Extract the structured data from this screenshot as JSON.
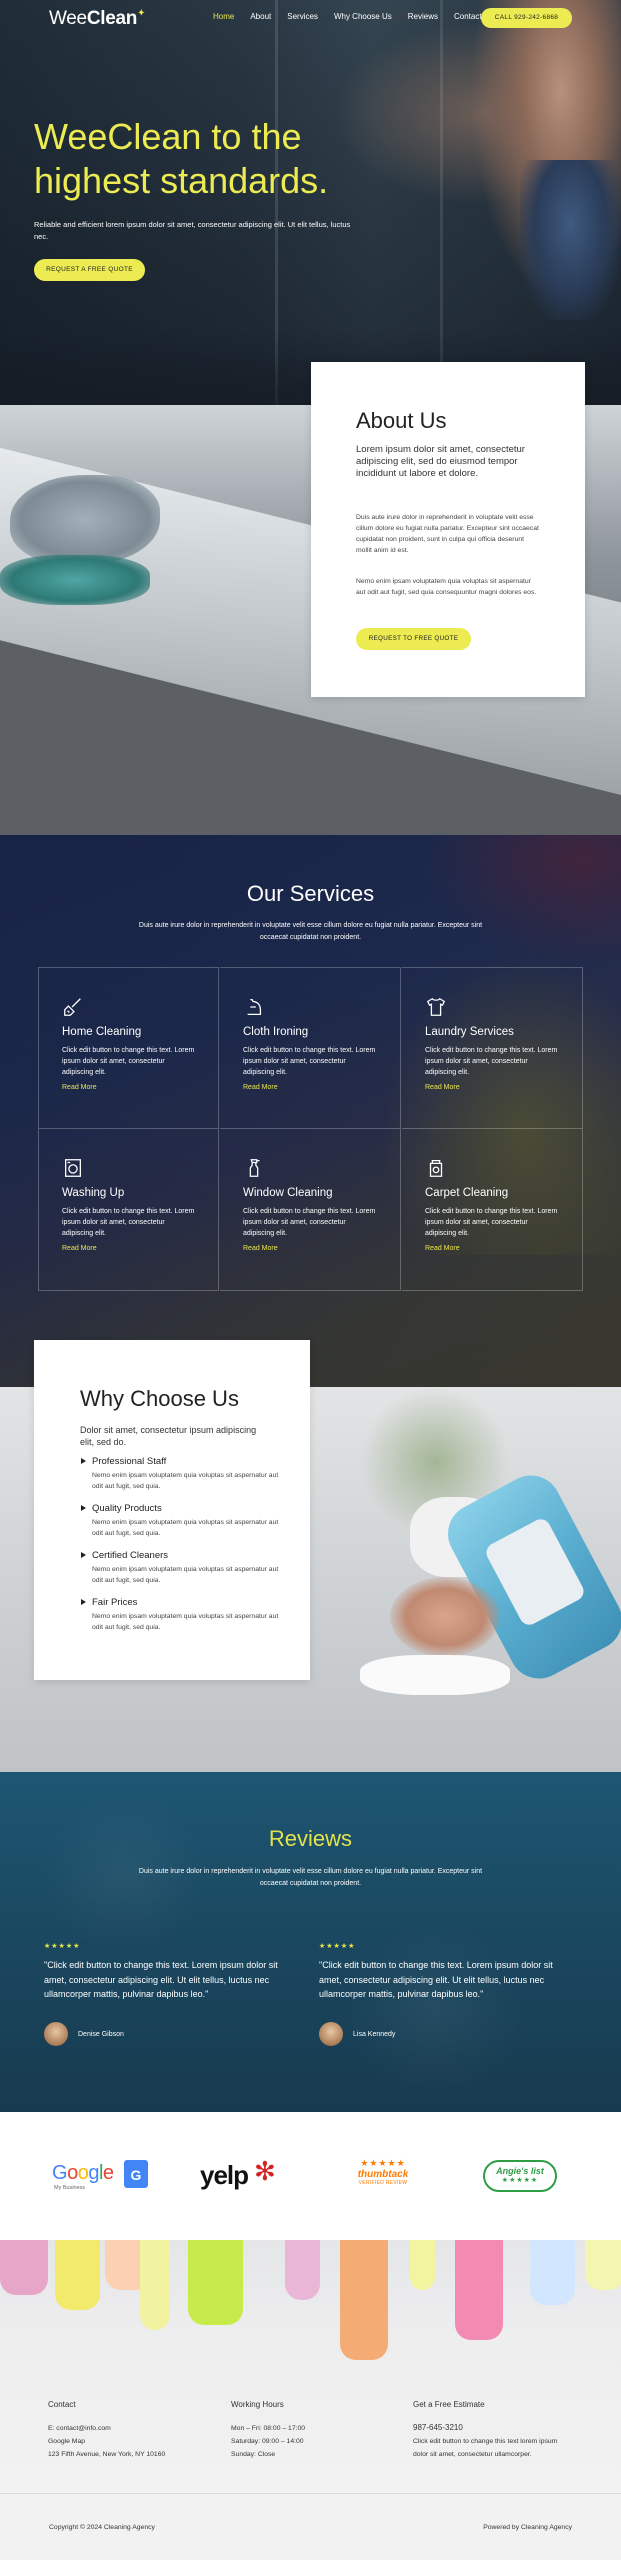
{
  "nav": {
    "logo_light": "Wee",
    "logo_bold": "Clean",
    "items": [
      "Home",
      "About",
      "Services",
      "Why Choose Us",
      "Reviews",
      "Contact"
    ],
    "call_label": "CALL 929-242-6868"
  },
  "hero": {
    "title": "WeeClean to the highest standards.",
    "subtitle": "Reliable and efficient lorem ipsum dolor sit amet, consectetur adipiscing elit. Ut elit tellus, luctus nec.",
    "button": "REQUEST A FREE QUOTE"
  },
  "about": {
    "title": "About Us",
    "lead": "Lorem ipsum dolor sit amet, consectetur adipiscing elit, sed do eiusmod tempor incididunt ut labore et dolore.",
    "p1": "Duis aute irure dolor in reprehenderit in voluptate velit esse cillum dolore eu fugiat nulla pariatur. Excepteur sint occaecat cupidatat non proident, sunt in culpa qui officia deserunt mollit anim id est.",
    "p2": "Nemo enim ipsam voluptatem quia voluptas sit aspernatur aut odit aut fugit, sed quia consequuntur magni dolores eos.",
    "button": "REQUEST TO FREE QUOTE"
  },
  "services": {
    "title": "Our Services",
    "intro": "Duis aute irure dolor in reprehenderit in voluptate velit esse cillum dolore eu fugiat nulla pariatur. Excepteur sint occaecat cupidatat non proident.",
    "items": [
      {
        "title": "Home Cleaning",
        "desc": "Click edit button to change this text. Lorem ipsum dolor sit amet, consectetur adipiscing elit.",
        "link": "Read More",
        "icon": "broom-icon"
      },
      {
        "title": "Cloth Ironing",
        "desc": "Click edit button to change this text. Lorem ipsum dolor sit amet, consectetur adipiscing elit.",
        "link": "Read More",
        "icon": "iron-icon"
      },
      {
        "title": "Laundry Services",
        "desc": "Click edit button to change this text. Lorem ipsum dolor sit amet, consectetur adipiscing elit.",
        "link": "Read More",
        "icon": "shirt-icon"
      },
      {
        "title": "Washing Up",
        "desc": "Click edit button to change this text. Lorem ipsum dolor sit amet, consectetur adipiscing elit.",
        "link": "Read More",
        "icon": "washing-machine-icon"
      },
      {
        "title": "Window Cleaning",
        "desc": "Click edit button to change this text. Lorem ipsum dolor sit amet, consectetur adipiscing elit.",
        "link": "Read More",
        "icon": "spray-bottle-icon"
      },
      {
        "title": "Carpet Cleaning",
        "desc": "Click edit button to change this text. Lorem ipsum dolor sit amet, consectetur adipiscing elit.",
        "link": "Read More",
        "icon": "vacuum-icon"
      }
    ]
  },
  "why": {
    "title": "Why Choose Us",
    "lead": "Dolor sit amet, consectetur ipsum adipiscing elit, sed do.",
    "items": [
      {
        "title": "Professional Staff",
        "desc": "Nemo enim ipsam voluptatem quia voluptas sit aspernatur aut odit aut fugit, sed quia."
      },
      {
        "title": "Quality Products",
        "desc": "Nemo enim ipsam voluptatem quia voluptas sit aspernatur aut odit aut fugit, sed quia."
      },
      {
        "title": "Certified Cleaners",
        "desc": "Nemo enim ipsam voluptatem quia voluptas sit aspernatur aut odit aut fugit, sed quia."
      },
      {
        "title": "Fair Prices",
        "desc": "Nemo enim ipsam voluptatem quia voluptas sit aspernatur aut odit aut fugit, sed quia."
      }
    ]
  },
  "reviews": {
    "title": "Reviews",
    "intro": "Duis aute irure dolor in reprehenderit in voluptate velit esse cillum dolore eu fugiat nulla pariatur. Excepteur sint occaecat cupidatat non proident.",
    "items": [
      {
        "stars": "★★★★★",
        "quote": "\"Click edit button to change this text. Lorem ipsum dolor sit amet, consectetur adipiscing elit. Ut elit tellus, luctus nec ullamcorper mattis, pulvinar dapibus leo.\"",
        "name": "Denise Gibson"
      },
      {
        "stars": "★★★★★",
        "quote": "\"Click edit button to change this text. Lorem ipsum dolor sit amet, consectetur adipiscing elit. Ut elit tellus, luctus nec ullamcorper mattis, pulvinar dapibus leo.\"",
        "name": "Lisa Kennedy"
      }
    ]
  },
  "logos": {
    "google": "Google",
    "google_sub": "My Business",
    "yelp": "yelp",
    "thumbtack_stars": "★★★★★",
    "thumbtack": "thumbtack",
    "thumbtack_sub": "VERIFIED REVIEW",
    "angies": "Angie's list",
    "angies_stars": "★★★★★"
  },
  "footer": {
    "contact_title": "Contact",
    "contact_lines": [
      "E: contact@info.com",
      "Google Map",
      "123 Fifth Avenue, New York, NY 10160"
    ],
    "hours_title": "Working Hours",
    "hours_lines": [
      "Mon – Fri: 08:00 – 17:00",
      "Saturday: 09:00 – 14:00",
      "Sunday: Close"
    ],
    "quote_title": "Get a Free Estimate",
    "quote_phone": "987-645-3210",
    "quote_text": "Click edit button to change this text lorem ipsum dolor sit amet, consectetur ullamcorper.",
    "copyright": "Copyright © 2024 Cleaning Agency",
    "powered": "Powered by Cleaning Agency"
  },
  "colors": {
    "accent": "#ecec52",
    "dark_text": "#222222",
    "review_bg": "#1d5673"
  }
}
